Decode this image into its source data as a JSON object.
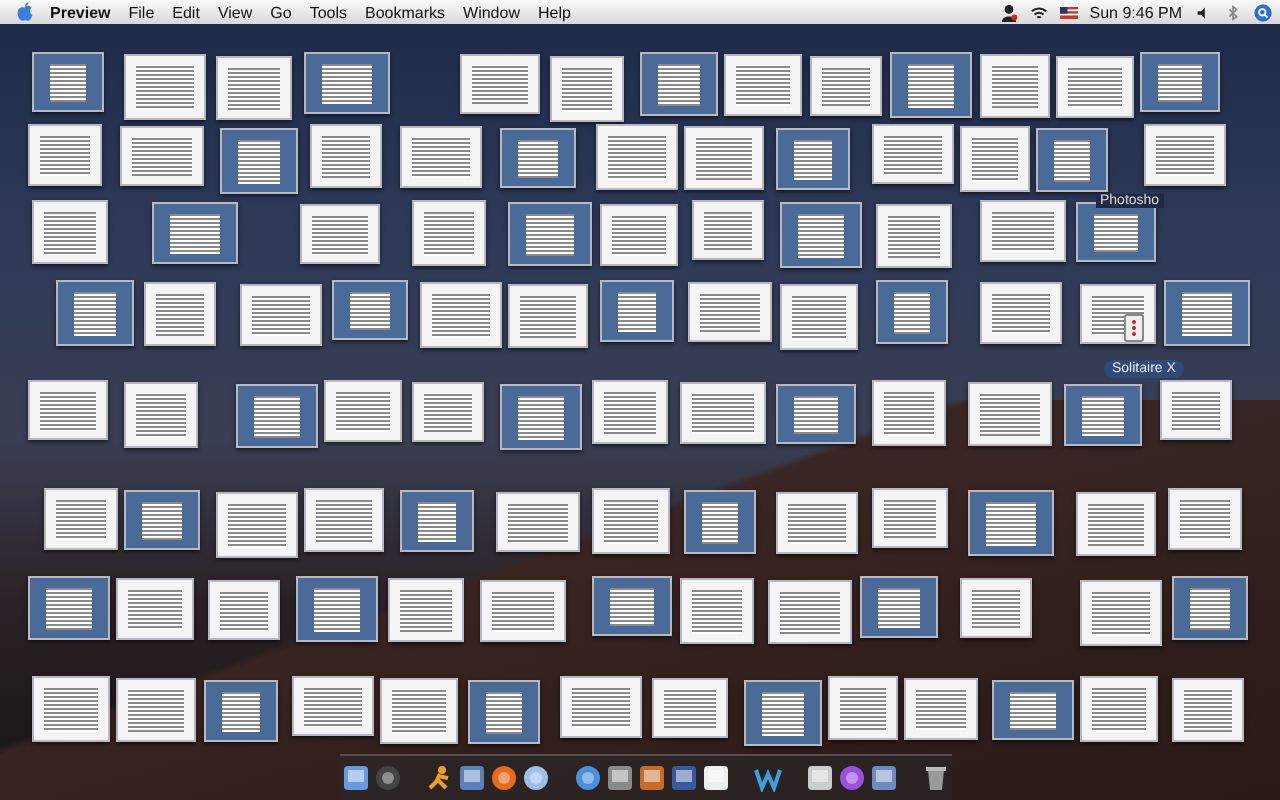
{
  "menu_bar": {
    "app_name": "Preview",
    "menus": [
      "File",
      "Edit",
      "View",
      "Go",
      "Tools",
      "Bookmarks",
      "Window",
      "Help"
    ],
    "clock": "Sun 9:46 PM"
  },
  "desktop_labels": [
    {
      "text": "Photosho",
      "kind": "plain"
    },
    {
      "text": "Solitaire X",
      "kind": "pill"
    }
  ]
}
